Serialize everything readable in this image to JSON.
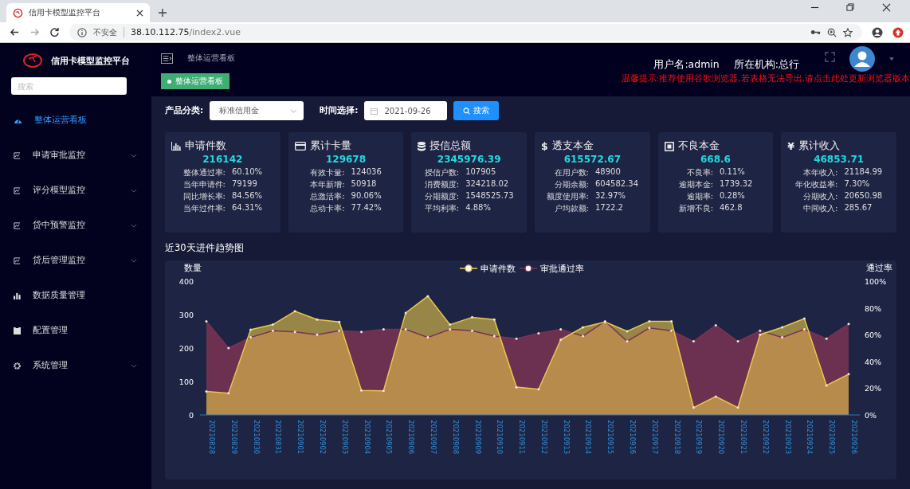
{
  "browser": {
    "tab_title": "信用卡模型监控平台",
    "security": "不安全",
    "url_host": "38.10.112.75",
    "url_path": "/index2.vue"
  },
  "sidebar": {
    "title": "信用卡模型监控平台",
    "search": {
      "placeholder": "搜索"
    },
    "items": [
      {
        "label": "整体运营看板",
        "kind": "dashboard",
        "expandable": false,
        "selected": true
      },
      {
        "label": "申请审批监控",
        "kind": "monitor",
        "expandable": true,
        "selected": false
      },
      {
        "label": "评分模型监控",
        "kind": "monitor",
        "expandable": true,
        "selected": false
      },
      {
        "label": "贷中预警监控",
        "kind": "monitor",
        "expandable": true,
        "selected": false
      },
      {
        "label": "贷后管理监控",
        "kind": "monitor",
        "expandable": true,
        "selected": false
      },
      {
        "label": "数据质量管理",
        "kind": "bars",
        "expandable": false,
        "selected": false
      },
      {
        "label": "配置管理",
        "kind": "folder",
        "expandable": false,
        "selected": false
      },
      {
        "label": "系统管理",
        "kind": "gear",
        "expandable": true,
        "selected": false
      }
    ]
  },
  "header": {
    "breadcrumb": "整体运营看板",
    "tag": "整体运营看板",
    "user": "用户名:admin",
    "org": "所在机构:总行",
    "notice": "温馨提示:推荐使用谷歌浏览器,若表格无法导出,请点击此处更新浏览器版本"
  },
  "filters": {
    "product_label": "产品分类:",
    "product_value": "标准信用金",
    "date_label": "时间选择:",
    "date_value": "2021-09-26",
    "search_button": "搜索"
  },
  "cards": [
    {
      "kind": "bar-chart",
      "title": "申请件数",
      "value": "216142",
      "rows": [
        {
          "label": "整体通过率:",
          "value": "60.10%"
        },
        {
          "label": "当年申请件:",
          "value": "79199"
        },
        {
          "label": "同比增长率:",
          "value": "84.56%"
        },
        {
          "label": "当年过件率:",
          "value": "64.31%"
        }
      ]
    },
    {
      "kind": "card",
      "title": "累计卡量",
      "value": "129678",
      "rows": [
        {
          "label": "有效卡量:",
          "value": "124036"
        },
        {
          "label": "本年新增:",
          "value": "50918"
        },
        {
          "label": "总激活率:",
          "value": "90.06%"
        },
        {
          "label": "总动卡率:",
          "value": "77.42%"
        }
      ]
    },
    {
      "kind": "database",
      "title": "授信总额",
      "value": "2345976.39",
      "rows": [
        {
          "label": "授信户数:",
          "value": "107905"
        },
        {
          "label": "消费额度:",
          "value": "324218.02"
        },
        {
          "label": "分期额度:",
          "value": "1548525.73"
        },
        {
          "label": "平均利率:",
          "value": "4.88%"
        }
      ]
    },
    {
      "kind": "glyph",
      "glyph": "$",
      "title": "透支本金",
      "value": "615572.67",
      "rows": [
        {
          "label": "在用户数:",
          "value": "48900"
        },
        {
          "label": "分期余额:",
          "value": "604582.34"
        },
        {
          "label": "额度使用率:",
          "value": "32.97%"
        },
        {
          "label": "户均款额:",
          "value": "1722.2"
        }
      ]
    },
    {
      "kind": "square",
      "title": "不良本金",
      "value": "668.6",
      "rows": [
        {
          "label": "不良率:",
          "value": "0.11%"
        },
        {
          "label": "逾期本金:",
          "value": "1739.32"
        },
        {
          "label": "逾期率:",
          "value": "0.28%"
        },
        {
          "label": "新增不良:",
          "value": "462.8"
        }
      ]
    },
    {
      "kind": "glyph",
      "glyph": "¥",
      "title": "累计收入",
      "value": "46853.71",
      "rows": [
        {
          "label": "本年收入:",
          "value": "21184.99"
        },
        {
          "label": "年化收益率:",
          "value": "7.30%"
        },
        {
          "label": "分期收入:",
          "value": "20650.98"
        },
        {
          "label": "中间收入:",
          "value": "285.67"
        }
      ]
    }
  ],
  "trend": {
    "title": "近30天进件趋势图",
    "right_axis": {
      "title": "通过率"
    },
    "chart_data": {
      "type": "area",
      "legend": "top",
      "ylabel": "数量",
      "categories": [
        "20210828",
        "20210829",
        "20210830",
        "20210831",
        "20210901",
        "20210902",
        "20210903",
        "20210904",
        "20210905",
        "20210906",
        "20210907",
        "20210908",
        "20210909",
        "20210910",
        "20210911",
        "20210912",
        "20210913",
        "20210914",
        "20210915",
        "20210916",
        "20210917",
        "20210918",
        "20210919",
        "20210920",
        "20210921",
        "20210922",
        "20210923",
        "20210924",
        "20210925",
        "20210926"
      ],
      "ylim": [
        0,
        400
      ],
      "yticks": [
        0,
        100,
        200,
        300,
        400
      ],
      "y2lim": [
        0,
        100
      ],
      "y2ticks": [
        {
          "value": 0,
          "label": "0%"
        },
        {
          "value": 20,
          "label": "20%"
        },
        {
          "value": 40,
          "label": "40%"
        },
        {
          "value": 60,
          "label": "60%"
        },
        {
          "value": 80,
          "label": "80%"
        },
        {
          "value": 100,
          "label": "100%"
        }
      ],
      "series": [
        {
          "name": "申请件数",
          "color": "#e8c84a",
          "values": [
            70,
            65,
            255,
            270,
            310,
            285,
            278,
            73,
            72,
            305,
            355,
            270,
            292,
            285,
            83,
            77,
            225,
            262,
            278,
            250,
            280,
            280,
            22,
            55,
            22,
            240,
            262,
            288,
            88,
            122
          ]
        },
        {
          "name": "审批通过率",
          "color": "#7a3354",
          "axis": "y2",
          "values": [
            70,
            50,
            58,
            63,
            62,
            60,
            63,
            62,
            64,
            64,
            58,
            64,
            63,
            59,
            57,
            61,
            64,
            59,
            70,
            55,
            65,
            63,
            55,
            67,
            55,
            63,
            58,
            64,
            57,
            68
          ]
        }
      ]
    }
  }
}
